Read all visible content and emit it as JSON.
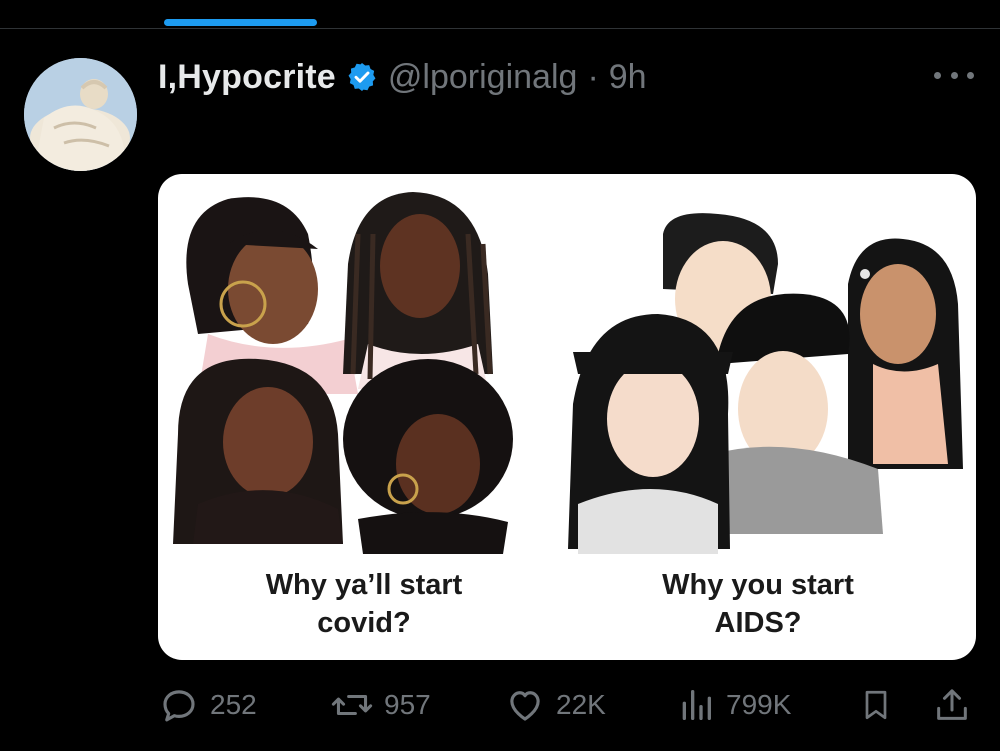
{
  "post": {
    "display_name": "I,Hypocrite",
    "handle": "@lporiginalg",
    "separator": "·",
    "time": "9h"
  },
  "media": {
    "caption_left": "Why ya’ll start\ncovid?",
    "caption_right": "Why you start\nAIDS?"
  },
  "actions": {
    "replies": "252",
    "reposts": "957",
    "likes": "22K",
    "views": "799K"
  },
  "colors": {
    "accent": "#1d9bf0",
    "muted": "#71767b",
    "text": "#e7e9ea",
    "background": "#000000"
  },
  "icons": [
    "verified-badge-icon",
    "more-icon",
    "reply-icon",
    "repost-icon",
    "like-icon",
    "views-icon",
    "bookmark-icon",
    "share-icon"
  ]
}
